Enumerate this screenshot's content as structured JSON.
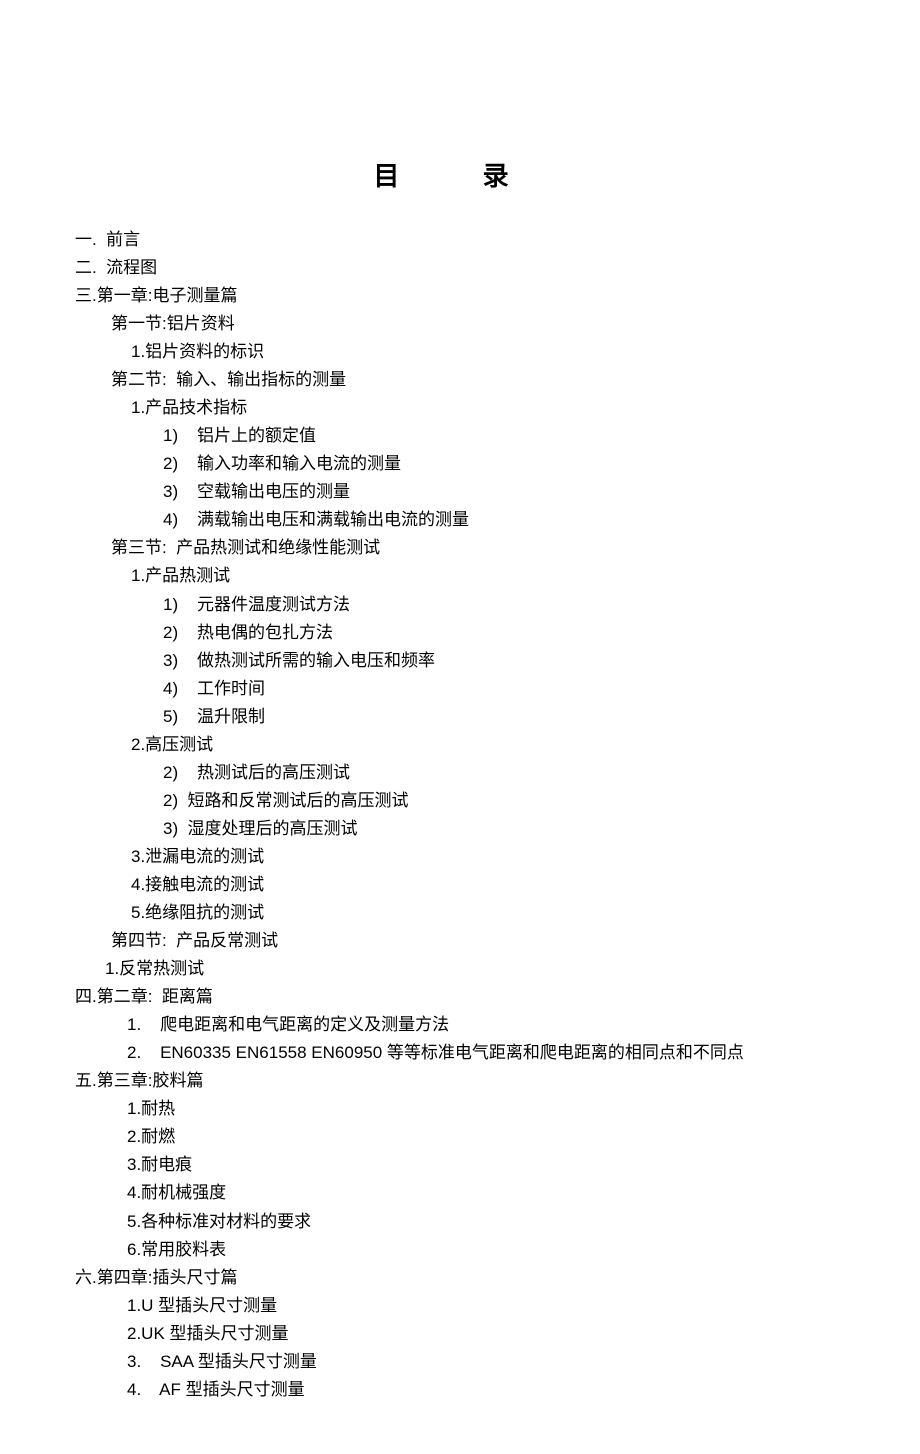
{
  "title": "目  录",
  "toc": {
    "sec1": "一.  前言",
    "sec2": "二.  流程图",
    "sec3": "三.第一章:电子测量篇",
    "s3_1": "第一节:铝片资料",
    "s3_1_1": "1.铝片资料的标识",
    "s3_2": "第二节:  输入、输出指标的测量",
    "s3_2_1": "1.产品技术指标",
    "s3_2_1_1": "1)    铝片上的额定值",
    "s3_2_1_2": "2)    输入功率和输入电流的测量",
    "s3_2_1_3": "3)    空载输出电压的测量",
    "s3_2_1_4": "4)    满载输出电压和满载输出电流的测量",
    "s3_3": "第三节:  产品热测试和绝缘性能测试",
    "s3_3_1": "1.产品热测试",
    "s3_3_1_1": "1)    元器件温度测试方法",
    "s3_3_1_2": "2)    热电偶的包扎方法",
    "s3_3_1_3": "3)    做热测试所需的输入电压和频率",
    "s3_3_1_4": "4)    工作时间",
    "s3_3_1_5": "5)    温升限制",
    "s3_3_2": "2.高压测试",
    "s3_3_2_1": "2)    热测试后的高压测试",
    "s3_3_2_2": "2)  短路和反常测试后的高压测试",
    "s3_3_2_3": "3)  湿度处理后的高压测试",
    "s3_3_3": "3.泄漏电流的测试",
    "s3_3_4": "4.接触电流的测试",
    "s3_3_5": "5.绝缘阻抗的测试",
    "s3_4": "第四节:  产品反常测试",
    "s3_4_1": "1.反常热测试",
    "sec4": "四.第二章:  距离篇",
    "s4_1": "1.    爬电距离和电气距离的定义及测量方法",
    "s4_2": "2.    EN60335 EN61558 EN60950 等等标准电气距离和爬电距离的相同点和不同点",
    "sec5": "五.第三章:胶料篇",
    "s5_1": "1.耐热",
    "s5_2": "2.耐燃",
    "s5_3": "3.耐电痕",
    "s5_4": "4.耐机械强度",
    "s5_5": "5.各种标准对材料的要求",
    "s5_6": "6.常用胶料表",
    "sec6": "六.第四章:插头尺寸篇",
    "s6_1": "1.U 型插头尺寸测量",
    "s6_2": "2.UK 型插头尺寸测量",
    "s6_3": "3.    SAA 型插头尺寸测量",
    "s6_4": "4.    AF 型插头尺寸测量"
  }
}
